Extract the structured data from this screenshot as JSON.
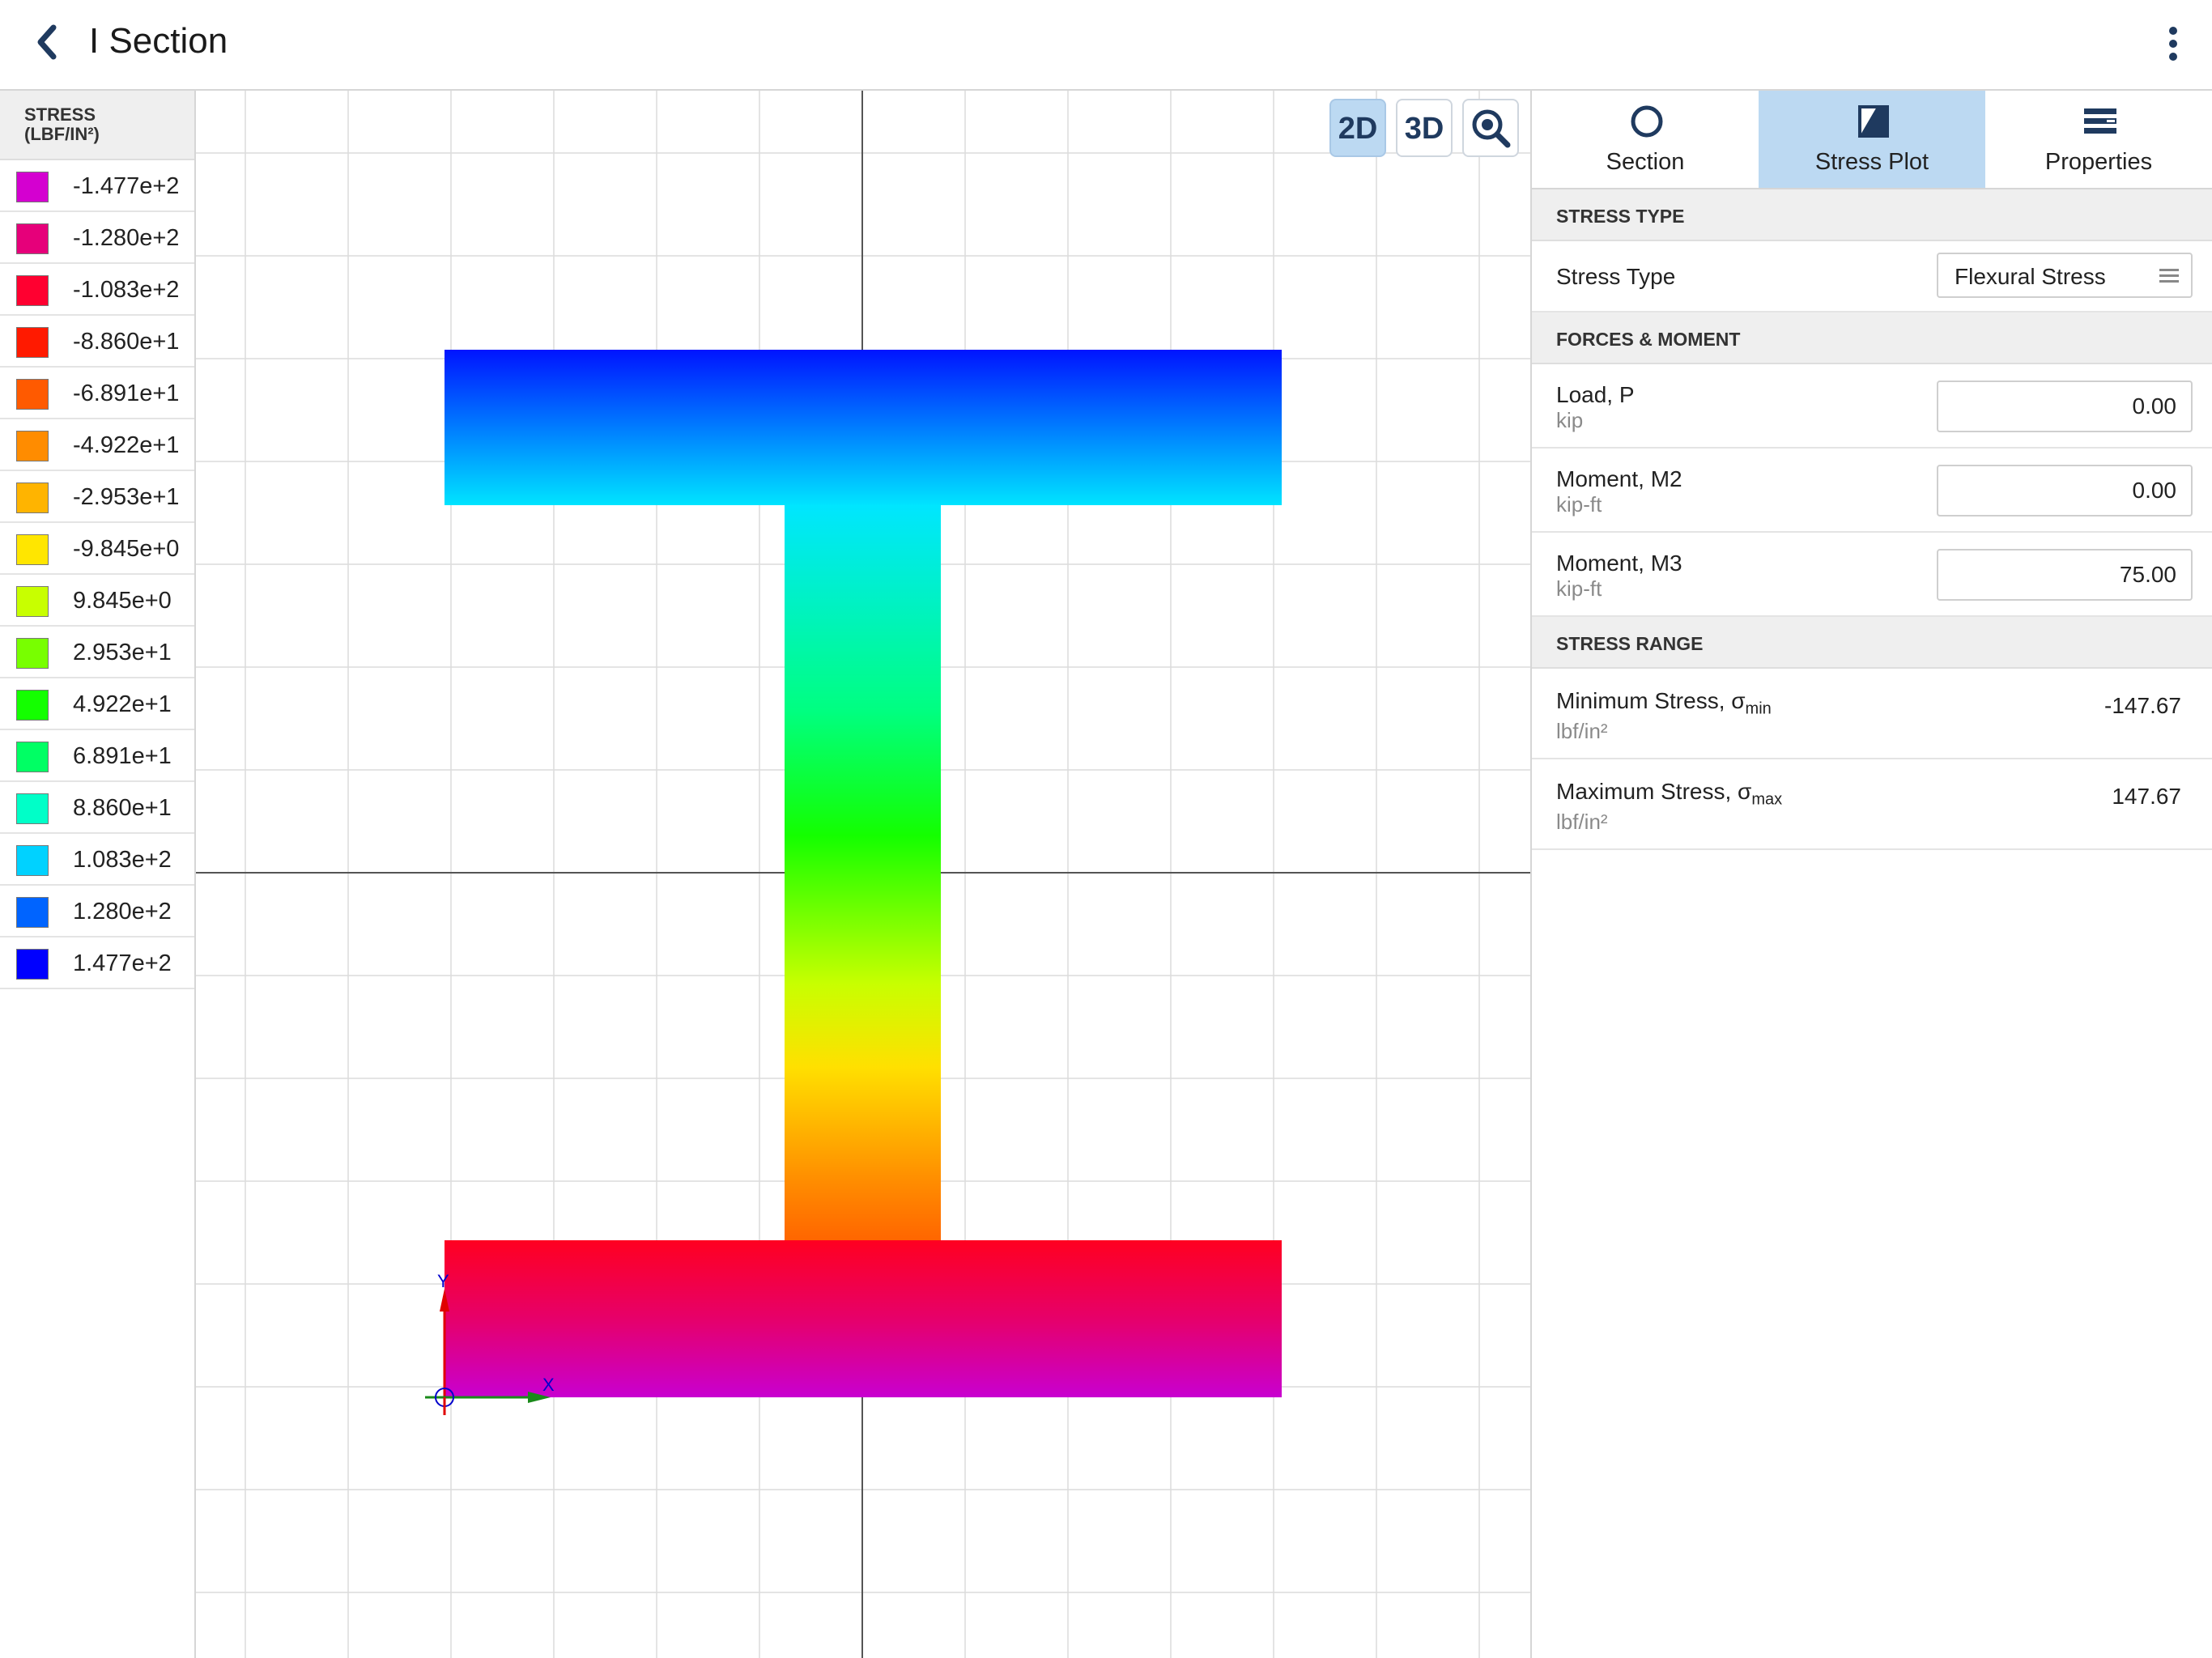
{
  "header": {
    "back_icon": "chevron-left-icon",
    "title": "I Section",
    "menu_icon": "more-vertical-icon"
  },
  "legend": {
    "title_line1": "STRESS",
    "title_line2": "(LBF/IN²)",
    "items": [
      {
        "value": "-1.477e+2",
        "color": "#d400d0"
      },
      {
        "value": "-1.280e+2",
        "color": "#e6007a"
      },
      {
        "value": "-1.083e+2",
        "color": "#ff0030"
      },
      {
        "value": "-8.860e+1",
        "color": "#ff1a00"
      },
      {
        "value": "-6.891e+1",
        "color": "#ff5a00"
      },
      {
        "value": "-4.922e+1",
        "color": "#ff8c00"
      },
      {
        "value": "-2.953e+1",
        "color": "#ffb400"
      },
      {
        "value": "-9.845e+0",
        "color": "#ffe600"
      },
      {
        "value": "9.845e+0",
        "color": "#c8ff00"
      },
      {
        "value": "2.953e+1",
        "color": "#78ff00"
      },
      {
        "value": "4.922e+1",
        "color": "#14ff00"
      },
      {
        "value": "6.891e+1",
        "color": "#00ff64"
      },
      {
        "value": "8.860e+1",
        "color": "#00ffc8"
      },
      {
        "value": "1.083e+2",
        "color": "#00d2ff"
      },
      {
        "value": "1.280e+2",
        "color": "#0064ff"
      },
      {
        "value": "1.477e+2",
        "color": "#0000ff"
      }
    ]
  },
  "view": {
    "btn_2d": "2D",
    "btn_3d": "3D",
    "zoom_icon": "zoom-icon",
    "active_mode": "2D",
    "axis_x_label": "X",
    "axis_y_label": "Y"
  },
  "panel": {
    "tabs": [
      {
        "label": "Section",
        "icon": "circle-icon",
        "active": false
      },
      {
        "label": "Stress Plot",
        "icon": "stress-plot-icon",
        "active": true
      },
      {
        "label": "Properties",
        "icon": "properties-icon",
        "active": false
      }
    ],
    "stress_type": {
      "header": "STRESS TYPE",
      "label": "Stress Type",
      "value": "Flexural Stress",
      "dropdown_icon": "list-icon"
    },
    "forces": {
      "header": "FORCES & MOMENT",
      "load_label": "Load, P",
      "load_unit": "kip",
      "load_value": "0.00",
      "m2_label": "Moment, M2",
      "m2_unit": "kip-ft",
      "m2_value": "0.00",
      "m3_label": "Moment, M3",
      "m3_unit": "kip-ft",
      "m3_value": "75.00"
    },
    "range": {
      "header": "STRESS RANGE",
      "min_label": "Minimum Stress, σ",
      "min_sub": "min",
      "min_unit": "lbf/in²",
      "min_value": "-147.67",
      "max_label": "Maximum Stress, σ",
      "max_sub": "max",
      "max_unit": "lbf/in²",
      "max_value": "147.67"
    }
  }
}
